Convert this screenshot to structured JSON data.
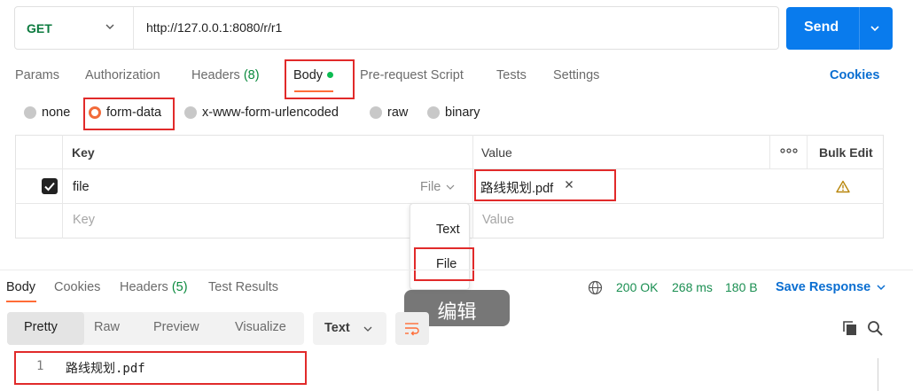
{
  "request": {
    "method": "GET",
    "url": "http://127.0.0.1:8080/r/r1",
    "send_label": "Send"
  },
  "request_tabs": {
    "params": "Params",
    "authorization": "Authorization",
    "headers": "Headers",
    "headers_count": "(8)",
    "body": "Body",
    "prerequest": "Pre-request Script",
    "tests": "Tests",
    "settings": "Settings",
    "cookies": "Cookies"
  },
  "body_types": {
    "none": "none",
    "form_data": "form-data",
    "urlencoded": "x-www-form-urlencoded",
    "raw": "raw",
    "binary": "binary",
    "selected": "form-data"
  },
  "table": {
    "key_header": "Key",
    "value_header": "Value",
    "more": "ooo",
    "bulk_edit": "Bulk Edit",
    "rows": [
      {
        "checked": true,
        "key": "file",
        "type": "File",
        "value": "路线规划.pdf"
      }
    ],
    "key_placeholder": "Key",
    "value_placeholder": "Value"
  },
  "type_dropdown": {
    "options": [
      "Text",
      "File"
    ],
    "selected": "File"
  },
  "tooltip": "编辑",
  "response": {
    "tabs": {
      "body": "Body",
      "cookies": "Cookies",
      "headers": "Headers",
      "headers_count": "(5)",
      "test_results": "Test Results"
    },
    "status": "200 OK",
    "time": "268 ms",
    "size": "180 B",
    "save_response": "Save Response",
    "views": [
      "Pretty",
      "Raw",
      "Preview",
      "Visualize"
    ],
    "format": "Text",
    "lines": [
      {
        "number": "1",
        "text": "路线规划.pdf"
      }
    ]
  },
  "colors": {
    "accent": "#ff6c37",
    "send": "#097bed",
    "link": "#0a6ed1",
    "status_ok": "#1b8f52",
    "highlight_box": "#e12a2a"
  }
}
